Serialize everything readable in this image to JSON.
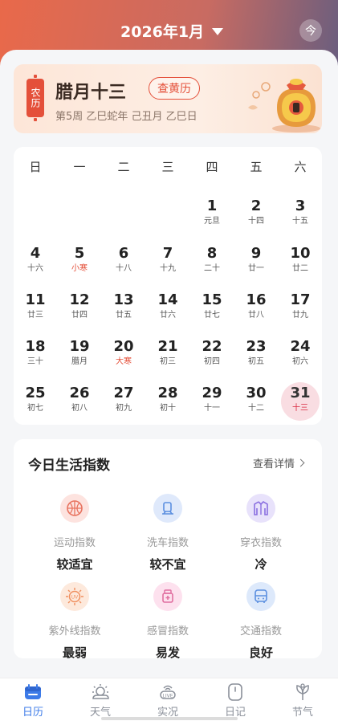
{
  "header": {
    "month": "2026年1月",
    "today_label": "今"
  },
  "lunar": {
    "tag": "农历",
    "date": "腊月十三",
    "almanac_button": "查黄历",
    "subline": "第5周  乙巳蛇年  己丑月  乙巳日"
  },
  "calendar": {
    "weekdays": [
      "日",
      "一",
      "二",
      "三",
      "四",
      "五",
      "六"
    ],
    "days": [
      {
        "num": "1",
        "lunar": "元旦"
      },
      {
        "num": "2",
        "lunar": "十四"
      },
      {
        "num": "3",
        "lunar": "十五"
      },
      {
        "num": "4",
        "lunar": "十六"
      },
      {
        "num": "5",
        "lunar": "小寒",
        "term": true
      },
      {
        "num": "6",
        "lunar": "十八"
      },
      {
        "num": "7",
        "lunar": "十九"
      },
      {
        "num": "8",
        "lunar": "二十"
      },
      {
        "num": "9",
        "lunar": "廿一"
      },
      {
        "num": "10",
        "lunar": "廿二"
      },
      {
        "num": "11",
        "lunar": "廿三"
      },
      {
        "num": "12",
        "lunar": "廿四"
      },
      {
        "num": "13",
        "lunar": "廿五"
      },
      {
        "num": "14",
        "lunar": "廿六"
      },
      {
        "num": "15",
        "lunar": "廿七"
      },
      {
        "num": "16",
        "lunar": "廿八"
      },
      {
        "num": "17",
        "lunar": "廿九"
      },
      {
        "num": "18",
        "lunar": "三十"
      },
      {
        "num": "19",
        "lunar": "腊月"
      },
      {
        "num": "20",
        "lunar": "大寒",
        "term": true
      },
      {
        "num": "21",
        "lunar": "初三"
      },
      {
        "num": "22",
        "lunar": "初四"
      },
      {
        "num": "23",
        "lunar": "初五"
      },
      {
        "num": "24",
        "lunar": "初六"
      },
      {
        "num": "25",
        "lunar": "初七"
      },
      {
        "num": "26",
        "lunar": "初八"
      },
      {
        "num": "27",
        "lunar": "初九"
      },
      {
        "num": "28",
        "lunar": "初十"
      },
      {
        "num": "29",
        "lunar": "十一"
      },
      {
        "num": "30",
        "lunar": "十二"
      },
      {
        "num": "31",
        "lunar": "十三",
        "today": true
      }
    ]
  },
  "life": {
    "title": "今日生活指数",
    "more": "查看详情",
    "items": [
      {
        "label": "运动指数",
        "value": "较适宜",
        "icon": "basketball-icon",
        "bg": "#fde3df"
      },
      {
        "label": "洗车指数",
        "value": "较不宜",
        "icon": "car-wash-icon",
        "bg": "#dfe9fb"
      },
      {
        "label": "穿衣指数",
        "value": "冷",
        "icon": "jacket-icon",
        "bg": "#e8e2fb"
      },
      {
        "label": "紫外线指数",
        "value": "最弱",
        "icon": "uv-icon",
        "bg": "#fde9dc"
      },
      {
        "label": "感冒指数",
        "value": "易发",
        "icon": "medicine-icon",
        "bg": "#fde1ee"
      },
      {
        "label": "交通指数",
        "value": "良好",
        "icon": "bus-icon",
        "bg": "#dde9fb"
      }
    ]
  },
  "tabs": [
    {
      "label": "日历",
      "icon": "calendar-icon",
      "active": true
    },
    {
      "label": "天气",
      "icon": "weather-icon"
    },
    {
      "label": "实况",
      "icon": "live-icon"
    },
    {
      "label": "日记",
      "icon": "diary-icon"
    },
    {
      "label": "节气",
      "icon": "solar-term-icon"
    }
  ],
  "colors": {
    "accent": "#e4503a",
    "today_bg": "#f9dde2",
    "active_tab": "#3d7be8"
  }
}
